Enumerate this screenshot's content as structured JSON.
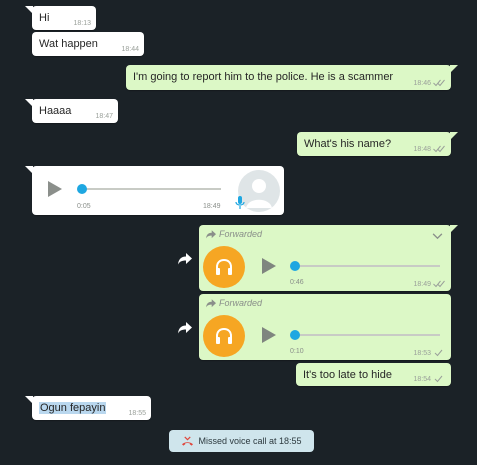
{
  "messages": {
    "m1": {
      "text": "Hi",
      "time": "18:13"
    },
    "m2": {
      "text": "Wat happen",
      "time": "18:44"
    },
    "m3": {
      "text": "I'm going to report him to the police. He is a scammer",
      "time": "18:46"
    },
    "m4": {
      "text": "Haaaa",
      "time": "18:47"
    },
    "m5": {
      "text": "What's his name?",
      "time": "18:48"
    },
    "voice1": {
      "duration": "0:05",
      "time": "18:49"
    },
    "fwd1": {
      "label": "Forwarded",
      "duration": "0:46",
      "time": "18:49"
    },
    "fwd2": {
      "label": "Forwarded",
      "duration": "0:10",
      "time": "18:53"
    },
    "m6": {
      "text": "It's too late to hide",
      "time": "18:54"
    },
    "m7": {
      "text": "Ogun fepayin",
      "time": "18:55"
    }
  },
  "system": {
    "missed_call": "Missed voice call at 18:55"
  },
  "colors": {
    "background": "#1b2227",
    "incoming_bubble": "#ffffff",
    "outgoing_bubble": "#dcf8c6",
    "audio_avatar": "#f6a623",
    "progress_dot": "#1ea7e1",
    "missed_call_icon": "#e0453b"
  },
  "icons": [
    "play-icon",
    "microphone-icon",
    "headphones-icon",
    "forward-icon",
    "share-icon",
    "chevron-down-icon",
    "double-check-icon",
    "single-check-icon",
    "missed-call-icon",
    "default-avatar-icon"
  ]
}
